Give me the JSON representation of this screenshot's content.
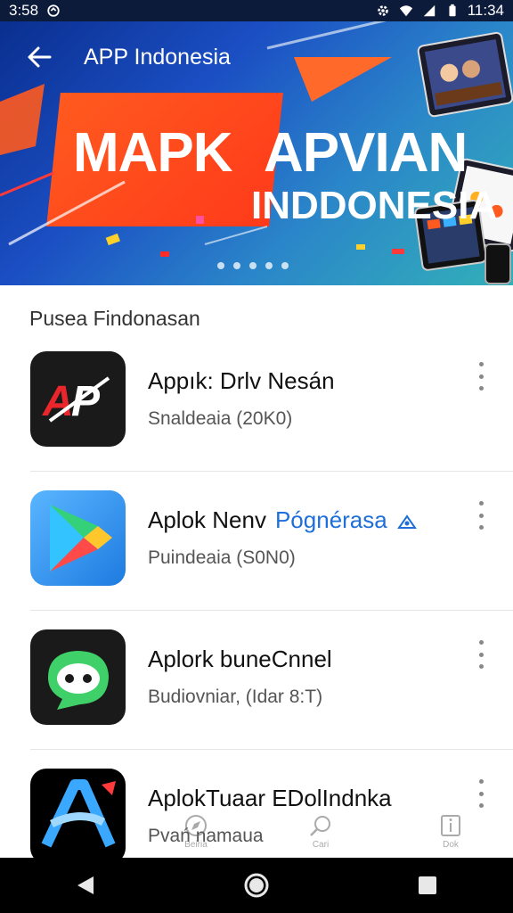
{
  "status_bar": {
    "time_left": "3:58",
    "time_right": "11:34"
  },
  "header": {
    "title": "APP Indonesia"
  },
  "banner": {
    "word1": "MAPK",
    "word2": "APVIAN",
    "word3": "INDDONESIA",
    "dot_count": 5
  },
  "section": {
    "title": "Pusea Findonasan"
  },
  "apps": [
    {
      "name": "Appık: Drlv Nesán",
      "meta": "Snaldeaia (20K0)",
      "icon": "ap-logo-icon",
      "tag": ""
    },
    {
      "name": "Aplok Nenv",
      "meta": "Puindeaia (S0N0)",
      "icon": "play-store-icon",
      "tag": "Pógnérasa"
    },
    {
      "name": "Aplork buneCnnel",
      "meta": "Budiovniar, (Idar 8:T)",
      "icon": "chat-bot-icon",
      "tag": ""
    },
    {
      "name": "AplokTuaar EDolIndnka",
      "meta": "Pvań namaua",
      "icon": "letter-a-icon",
      "tag": ""
    }
  ],
  "bottom_tabs": [
    {
      "label": "Beiria",
      "icon": "compass-icon"
    },
    {
      "label": "Cari",
      "icon": "search-icon"
    },
    {
      "label": "Dok",
      "icon": "info-icon"
    }
  ],
  "colors": {
    "accent": "#1e6fd9",
    "banner_orange": "#ff4a1c",
    "status_bar": "#0d1b3a"
  }
}
